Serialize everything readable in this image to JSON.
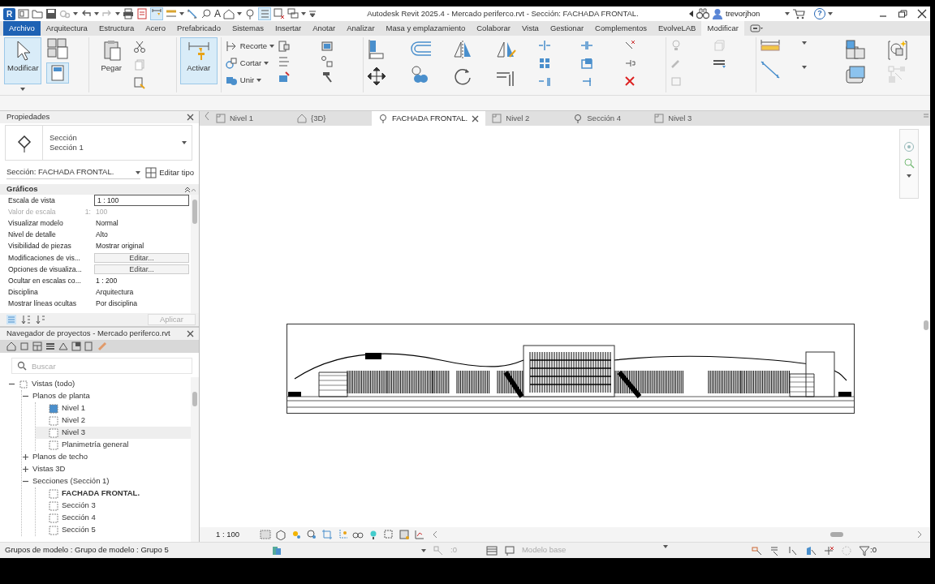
{
  "app_logo": "R",
  "quick_access_text": "A",
  "window": {
    "title": "Autodesk Revit 2025.4 - Mercado periferco.rvt - Sección: FACHADA FRONTAL.",
    "user": "trevorjhon",
    "help": "?"
  },
  "menu_tabs": [
    {
      "label": "Archivo",
      "kind": "file",
      "selected": false
    },
    {
      "label": "Arquitectura",
      "kind": "tab",
      "selected": false
    },
    {
      "label": "Estructura",
      "kind": "tab",
      "selected": false
    },
    {
      "label": "Acero",
      "kind": "tab",
      "selected": false
    },
    {
      "label": "Prefabricado",
      "kind": "tab",
      "selected": false
    },
    {
      "label": "Sistemas",
      "kind": "tab",
      "selected": false
    },
    {
      "label": "Insertar",
      "kind": "tab",
      "selected": false
    },
    {
      "label": "Anotar",
      "kind": "tab",
      "selected": false
    },
    {
      "label": "Analizar",
      "kind": "tab",
      "selected": false
    },
    {
      "label": "Masa y emplazamiento",
      "kind": "tab",
      "selected": false
    },
    {
      "label": "Colaborar",
      "kind": "tab",
      "selected": false
    },
    {
      "label": "Vista",
      "kind": "tab",
      "selected": false
    },
    {
      "label": "Gestionar",
      "kind": "tab",
      "selected": false
    },
    {
      "label": "Complementos",
      "kind": "tab",
      "selected": false
    },
    {
      "label": "EvolveLAB",
      "kind": "tab",
      "selected": false
    },
    {
      "label": "Modificar",
      "kind": "tab",
      "selected": true
    }
  ],
  "ribbon": {
    "large_tools": [
      {
        "label": "Modificar",
        "active": true
      },
      {
        "label": "Pegar",
        "active": false
      },
      {
        "label": "Activar",
        "active": true
      }
    ],
    "split_tools": [
      {
        "label": "Recorte"
      },
      {
        "label": "Cortar"
      },
      {
        "label": "Unir"
      }
    ]
  },
  "properties": {
    "title": "Propiedades",
    "type_family": "Sección",
    "type_name": "Sección 1",
    "instance": "Sección: FACHADA FRONTAL.",
    "edit_type": "Editar tipo",
    "group": "Gráficos",
    "rows": [
      {
        "label": "Escala de vista",
        "value": "1 : 100",
        "kind": "input",
        "disabled": false
      },
      {
        "label": "Valor de escala",
        "prefix": "1:",
        "value": "100",
        "kind": "text",
        "disabled": true
      },
      {
        "label": "Visualizar modelo",
        "value": "Normal",
        "kind": "text",
        "disabled": false
      },
      {
        "label": "Nivel de detalle",
        "value": "Alto",
        "kind": "text",
        "disabled": false
      },
      {
        "label": "Visibilidad de piezas",
        "value": "Mostrar original",
        "kind": "text",
        "disabled": false
      },
      {
        "label": "Modificaciones de vis...",
        "value": "Editar...",
        "kind": "button",
        "disabled": false
      },
      {
        "label": "Opciones de visualiza...",
        "value": "Editar...",
        "kind": "button",
        "disabled": false
      },
      {
        "label": "Ocultar en escalas co...",
        "value": "1 : 200",
        "kind": "text",
        "disabled": false
      },
      {
        "label": "Disciplina",
        "value": "Arquitectura",
        "kind": "text",
        "disabled": false
      },
      {
        "label": "Mostrar líneas ocultas",
        "value": "Por disciplina",
        "kind": "text",
        "disabled": false
      }
    ],
    "apply": "Aplicar",
    "apply_disabled": true
  },
  "browser": {
    "title": "Navegador de proyectos - Mercado periferco.rvt",
    "search_placeholder": "Buscar",
    "tree": [
      {
        "label": "Vistas (todo)",
        "kind": "folder",
        "expanded": true,
        "children": [
          {
            "label": "Planos de planta",
            "kind": "folder",
            "expanded": true,
            "children": [
              {
                "label": "Nivel 1",
                "open": true,
                "selected": false,
                "current": false
              },
              {
                "label": "Nivel 2",
                "open": false,
                "selected": false,
                "current": false
              },
              {
                "label": "Nivel 3",
                "open": false,
                "selected": true,
                "current": false
              },
              {
                "label": "Planimetría general",
                "open": false,
                "selected": false,
                "current": false
              }
            ]
          },
          {
            "label": "Planos de techo",
            "kind": "folder",
            "expanded": false
          },
          {
            "label": "Vistas 3D",
            "kind": "folder",
            "expanded": false
          },
          {
            "label": "Secciones (Sección 1)",
            "kind": "folder",
            "expanded": true,
            "children": [
              {
                "label": "FACHADA FRONTAL.",
                "open": false,
                "selected": false,
                "current": true
              },
              {
                "label": "Sección 3",
                "open": false,
                "selected": false,
                "current": false
              },
              {
                "label": "Sección 4",
                "open": false,
                "selected": false,
                "current": false
              },
              {
                "label": "Sección 5",
                "open": false,
                "selected": false,
                "current": false
              }
            ]
          }
        ]
      }
    ]
  },
  "view_tabs": [
    {
      "label": "Nivel 1",
      "kind": "plan",
      "selected": false
    },
    {
      "label": "{3D}",
      "kind": "model",
      "selected": false
    },
    {
      "label": "FACHADA FRONTAL.",
      "kind": "section",
      "selected": true
    },
    {
      "label": "Nivel 2",
      "kind": "plan",
      "selected": false
    },
    {
      "label": "Sección 4",
      "kind": "section",
      "selected": false
    },
    {
      "label": "Nivel 3",
      "kind": "plan",
      "selected": false
    }
  ],
  "view_bar": {
    "scale": "1 : 100"
  },
  "status_bar": {
    "message": "Grupos de modelo : Grupo de modelo : Grupo 5",
    "count": ":0",
    "workset": "Modelo base",
    "filter_count": ":0"
  }
}
